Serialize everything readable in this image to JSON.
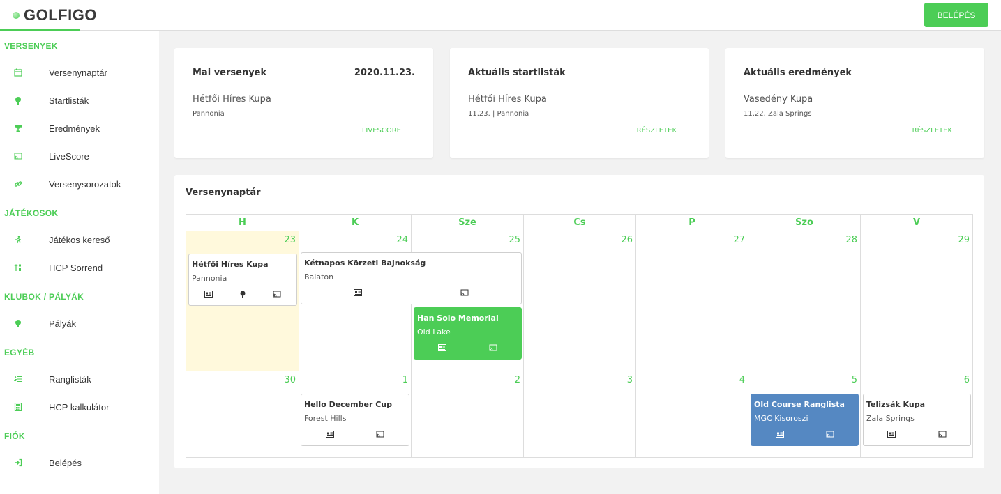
{
  "brand": {
    "logo": "GOLFIGO"
  },
  "header": {
    "login_label": "BELÉPÉS"
  },
  "sidebar": {
    "sections": [
      {
        "title": "VERSENYEK",
        "items": [
          {
            "label": "Versenynaptár",
            "icon": "calendar-icon"
          },
          {
            "label": "Startlisták",
            "icon": "golf-ball-tee-icon"
          },
          {
            "label": "Eredmények",
            "icon": "trophy-icon"
          },
          {
            "label": "LiveScore",
            "icon": "cast-icon"
          },
          {
            "label": "Versenysorozatok",
            "icon": "link-icon"
          }
        ]
      },
      {
        "title": "JÁTÉKOSOK",
        "items": [
          {
            "label": "Játékos kereső",
            "icon": "running-person-icon"
          },
          {
            "label": "HCP Sorrend",
            "icon": "sort-icon"
          }
        ]
      },
      {
        "title": "KLUBOK / PÁLYÁK",
        "items": [
          {
            "label": "Pályák",
            "icon": "golf-ball-tee-icon"
          }
        ]
      },
      {
        "title": "EGYÉB",
        "items": [
          {
            "label": "Ranglisták",
            "icon": "list-ordered-icon"
          },
          {
            "label": "HCP kalkulátor",
            "icon": "calculator-icon"
          }
        ]
      },
      {
        "title": "FIÓK",
        "items": [
          {
            "label": "Belépés",
            "icon": "sign-in-icon"
          }
        ]
      }
    ]
  },
  "cards": [
    {
      "title": "Mai versenyek",
      "date": "2020.11.23.",
      "event": "Hétfői Híres Kupa",
      "sub": "Pannonia",
      "link": "LIVESCORE"
    },
    {
      "title": "Aktuális startlisták",
      "date": "",
      "event": "Hétfői Híres Kupa",
      "sub": "11.23. | Pannonia",
      "link": "RÉSZLETEK"
    },
    {
      "title": "Aktuális eredmények",
      "date": "",
      "event": "Vasedény Kupa",
      "sub": "11.22. Zala Springs",
      "link": "RÉSZLETEK"
    }
  ],
  "calendar": {
    "title": "Versenynaptár",
    "weekdays": [
      "H",
      "K",
      "Sze",
      "Cs",
      "P",
      "Szo",
      "V"
    ],
    "weeks": [
      [
        "23",
        "24",
        "25",
        "26",
        "27",
        "28",
        "29"
      ],
      [
        "30",
        "1",
        "2",
        "3",
        "4",
        "5",
        "6"
      ]
    ],
    "events": [
      {
        "title": "Hétfői Híres Kupa",
        "location": "Pannonia",
        "style": "white",
        "icons": [
          "id-card-icon",
          "golf-ball-tee-icon",
          "cast-icon"
        ]
      },
      {
        "title": "Kétnapos Körzeti Bajnokság",
        "location": "Balaton",
        "style": "white",
        "icons": [
          "id-card-icon",
          "cast-icon"
        ]
      },
      {
        "title": "Han Solo Memorial",
        "location": "Old Lake",
        "style": "green",
        "icons": [
          "id-card-icon",
          "cast-icon"
        ]
      },
      {
        "title": "Hello December Cup",
        "location": "Forest Hills",
        "style": "white",
        "icons": [
          "id-card-icon",
          "cast-icon"
        ]
      },
      {
        "title": "Old Course Ranglista",
        "location": "MGC Kisoroszi",
        "style": "blue",
        "icons": [
          "id-card-icon",
          "cast-icon"
        ]
      },
      {
        "title": "Telizsák Kupa",
        "location": "Zala Springs",
        "style": "white",
        "icons": [
          "id-card-icon",
          "cast-icon"
        ]
      }
    ]
  },
  "colors": {
    "accent": "#4ccd56",
    "blue_event": "#5588c2",
    "today_bg": "#fff9dc"
  }
}
